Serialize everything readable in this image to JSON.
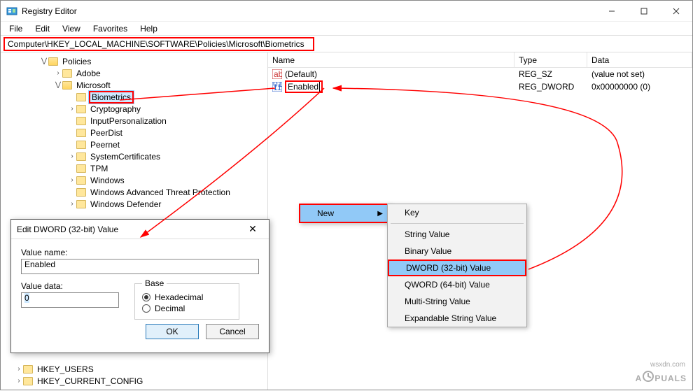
{
  "window": {
    "title": "Registry Editor",
    "menus": [
      "File",
      "Edit",
      "View",
      "Favorites",
      "Help"
    ],
    "address": "Computer\\HKEY_LOCAL_MACHINE\\SOFTWARE\\Policies\\Microsoft\\Biometrics"
  },
  "tree": {
    "policies": "Policies",
    "adobe": "Adobe",
    "microsoft": "Microsoft",
    "children": [
      "Biometrics",
      "Cryptography",
      "InputPersonalization",
      "PeerDist",
      "Peernet",
      "SystemCertificates",
      "TPM",
      "Windows",
      "Windows Advanced Threat Protection",
      "Windows Defender"
    ],
    "bottom": [
      "HKEY_USERS",
      "HKEY_CURRENT_CONFIG"
    ]
  },
  "list": {
    "headers": {
      "name": "Name",
      "type": "Type",
      "data": "Data"
    },
    "rows": [
      {
        "name": "(Default)",
        "type": "REG_SZ",
        "data": "(value not set)",
        "icon": "ab"
      },
      {
        "name": "Enabled",
        "type": "REG_DWORD",
        "data": "0x00000000 (0)",
        "icon": "bin",
        "editing": true
      }
    ]
  },
  "context_menu1": {
    "new": "New"
  },
  "context_menu2": {
    "items": [
      "Key",
      "String Value",
      "Binary Value",
      "DWORD (32-bit) Value",
      "QWORD (64-bit) Value",
      "Multi-String Value",
      "Expandable String Value"
    ],
    "highlighted": "DWORD (32-bit) Value"
  },
  "dialog": {
    "title": "Edit DWORD (32-bit) Value",
    "value_name_label": "Value name:",
    "value_name": "Enabled",
    "value_data_label": "Value data:",
    "value_data": "0",
    "base_label": "Base",
    "hex": "Hexadecimal",
    "dec": "Decimal",
    "ok": "OK",
    "cancel": "Cancel"
  },
  "watermark": "A  PUALS",
  "wsxdn": "wsxdn.com"
}
